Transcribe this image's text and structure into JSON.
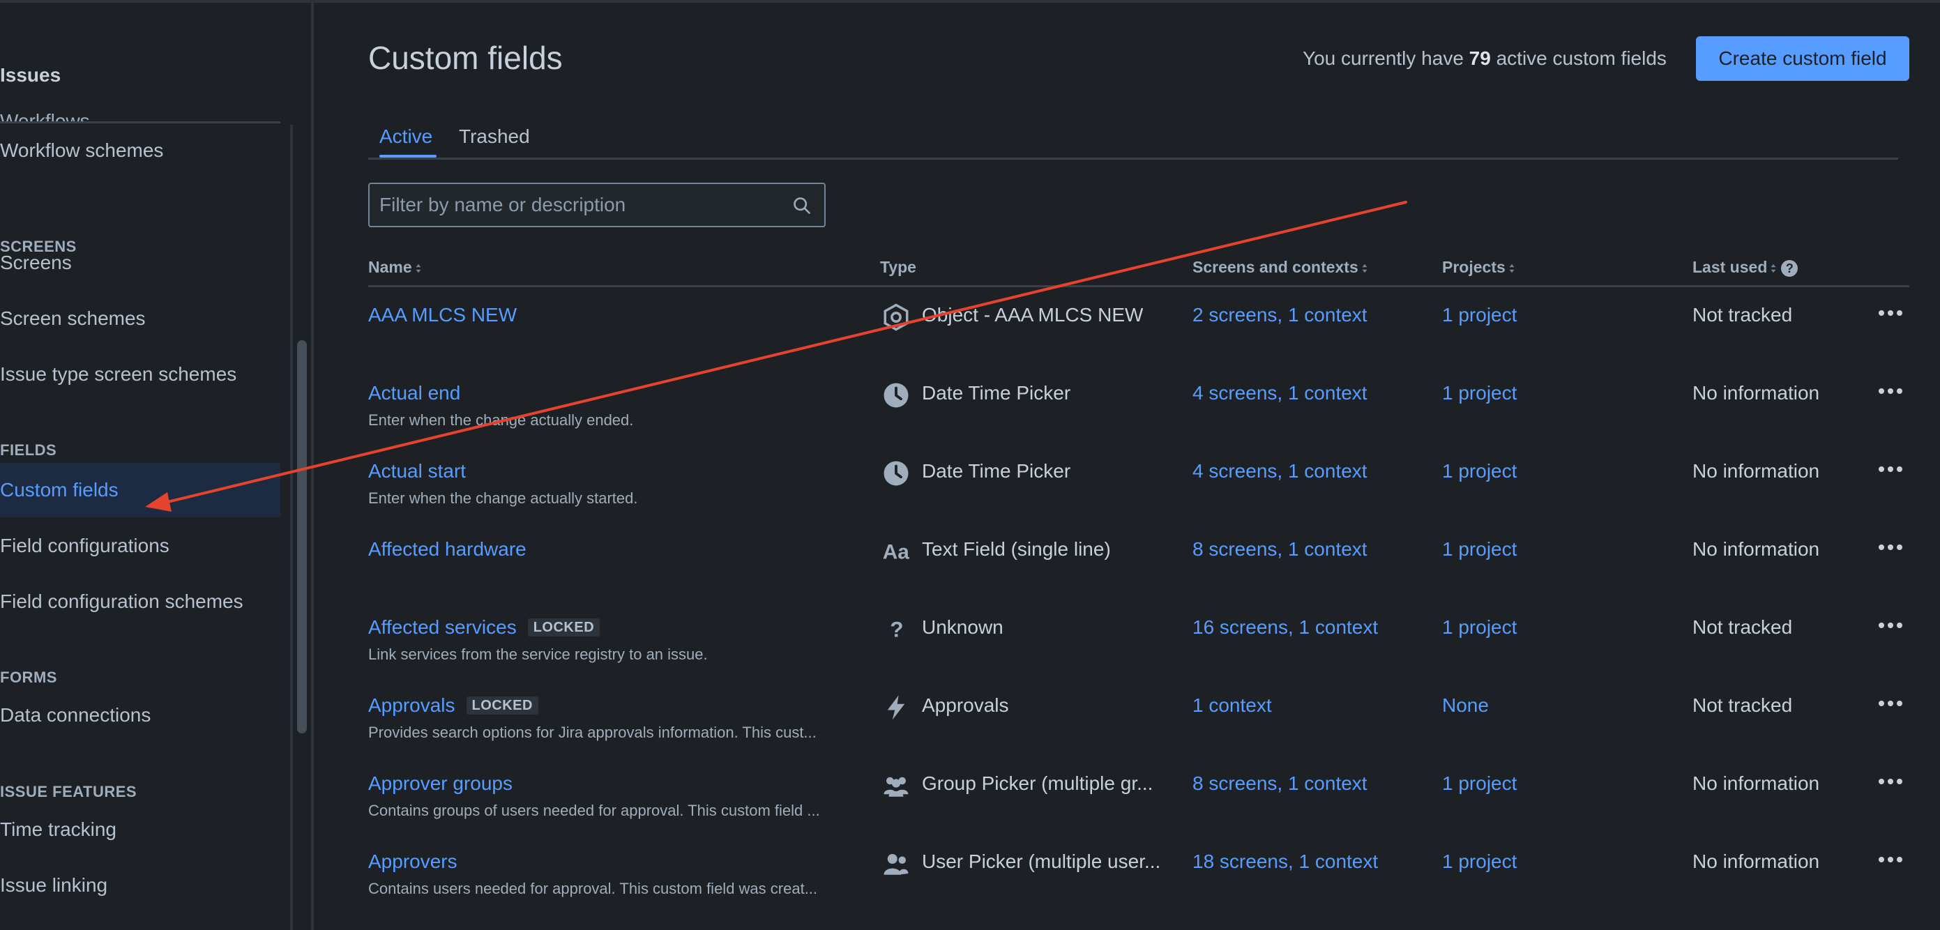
{
  "sidebar": {
    "heading": "Issues",
    "cut_item": "Workflows",
    "items": [
      {
        "label": "Workflow schemes"
      },
      {
        "section": "SCREENS"
      },
      {
        "label": "Screens"
      },
      {
        "label": "Screen schemes"
      },
      {
        "label": "Issue type screen schemes"
      },
      {
        "section": "FIELDS"
      },
      {
        "label": "Custom fields",
        "active": true
      },
      {
        "label": "Field configurations"
      },
      {
        "label": "Field configuration schemes"
      },
      {
        "section": "FORMS"
      },
      {
        "label": "Data connections"
      },
      {
        "section": "ISSUE FEATURES"
      },
      {
        "label": "Time tracking"
      },
      {
        "label": "Issue linking"
      }
    ]
  },
  "header": {
    "title": "Custom fields",
    "count_prefix": "You currently have",
    "count_value": "79",
    "count_suffix": "active custom fields",
    "create_label": "Create custom field"
  },
  "tabs": {
    "active": "Active",
    "trashed": "Trashed"
  },
  "filter": {
    "placeholder": "Filter by name or description"
  },
  "columns": {
    "name": "Name",
    "type": "Type",
    "screens": "Screens and contexts",
    "projects": "Projects",
    "last_used": "Last used"
  },
  "rows": [
    {
      "name": "AAA MLCS NEW",
      "locked": "",
      "desc": "",
      "type_icon": "object-icon",
      "type": "Object - AAA MLCS NEW",
      "screens": "2 screens, 1 context",
      "projects": "1 project",
      "last_used": "Not tracked"
    },
    {
      "name": "Actual end",
      "locked": "",
      "desc": "Enter when the change actually ended.",
      "type_icon": "clock-icon",
      "type": "Date Time Picker",
      "screens": "4 screens, 1 context",
      "projects": "1 project",
      "last_used": "No information"
    },
    {
      "name": "Actual start",
      "locked": "",
      "desc": "Enter when the change actually started.",
      "type_icon": "clock-icon",
      "type": "Date Time Picker",
      "screens": "4 screens, 1 context",
      "projects": "1 project",
      "last_used": "No information"
    },
    {
      "name": "Affected hardware",
      "locked": "",
      "desc": "",
      "type_icon": "text-icon",
      "type": "Text Field (single line)",
      "screens": "8 screens, 1 context",
      "projects": "1 project",
      "last_used": "No information"
    },
    {
      "name": "Affected services",
      "locked": "LOCKED",
      "desc": "Link services from the service registry to an issue.",
      "type_icon": "question-icon",
      "type": "Unknown",
      "screens": "16 screens, 1 context",
      "projects": "1 project",
      "last_used": "Not tracked"
    },
    {
      "name": "Approvals",
      "locked": "LOCKED",
      "desc": "Provides search options for Jira approvals information. This cust...",
      "type_icon": "bolt-icon",
      "type": "Approvals",
      "screens": "1 context",
      "projects": "None",
      "last_used": "Not tracked"
    },
    {
      "name": "Approver groups",
      "locked": "",
      "desc": "Contains groups of users needed for approval. This custom field ...",
      "type_icon": "group-icon",
      "type": "Group Picker (multiple gr...",
      "screens": "8 screens, 1 context",
      "projects": "1 project",
      "last_used": "No information"
    },
    {
      "name": "Approvers",
      "locked": "",
      "desc": "Contains users needed for approval. This custom field was creat...",
      "type_icon": "users-icon",
      "type": "User Picker (multiple user...",
      "screens": "18 screens, 1 context",
      "projects": "1 project",
      "last_used": "No information"
    }
  ],
  "colors": {
    "background": "#1d2125",
    "link": "#579dff",
    "active_nav_bg": "#1c2b41",
    "annotation_arrow": "#e5432e"
  }
}
